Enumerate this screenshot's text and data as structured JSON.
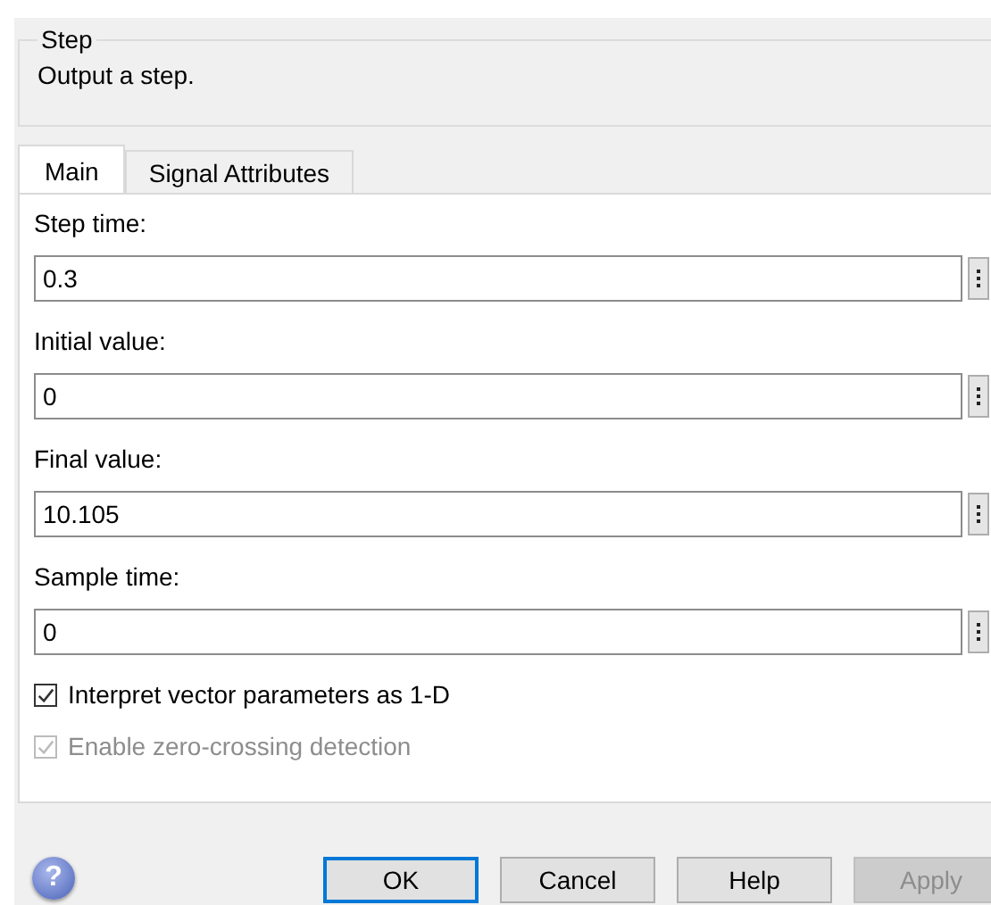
{
  "group": {
    "title": "Step",
    "description": "Output a step."
  },
  "tabs": [
    {
      "label": "Main",
      "selected": true
    },
    {
      "label": "Signal Attributes",
      "selected": false
    }
  ],
  "parameters": [
    {
      "label": "Step time:",
      "value": "0.3"
    },
    {
      "label": "Initial value:",
      "value": "0"
    },
    {
      "label": "Final value:",
      "value": "10.105"
    },
    {
      "label": "Sample time:",
      "value": "0"
    }
  ],
  "options": [
    {
      "label": "Interpret vector parameters as 1-D",
      "checked": true,
      "disabled": false
    },
    {
      "label": "Enable zero-crossing detection",
      "checked": true,
      "disabled": true
    }
  ],
  "help_icon": "?",
  "buttons": [
    {
      "label": "OK",
      "default": true,
      "disabled": false
    },
    {
      "label": "Cancel",
      "default": false,
      "disabled": false
    },
    {
      "label": "Help",
      "default": false,
      "disabled": false
    },
    {
      "label": "Apply",
      "default": false,
      "disabled": true
    }
  ]
}
